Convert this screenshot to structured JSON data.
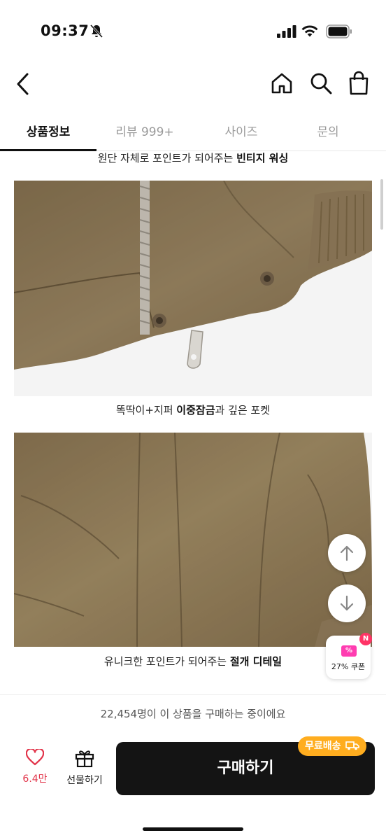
{
  "status_bar": {
    "time": "09:37"
  },
  "tabs": [
    {
      "label": "상품정보"
    },
    {
      "label": "리뷰 999+"
    },
    {
      "label": "사이즈"
    },
    {
      "label": "문의"
    }
  ],
  "captions": {
    "vintage_prefix": "원단 자체로 포인트가 되어주는 ",
    "vintage_bold": "빈티지 워싱",
    "zipper_prefix": "똑딱이+지퍼 ",
    "zipper_bold": "이중잠금",
    "zipper_suffix": "과 깊은 포켓",
    "detail_prefix": "유니크한 포인트가 되어주는 ",
    "detail_bold": "절개 디테일"
  },
  "floating": {
    "coupon_label": "27% 쿠폰",
    "coupon_badge": "N",
    "coupon_icon": "%"
  },
  "purchase": {
    "buyers_text": "22,454명이 이 상품을 구매하는 중이에요",
    "like_count": "6.4만",
    "gift_label": "선물하기",
    "buy_label": "구매하기",
    "free_shipping": "무료배송"
  },
  "colors": {
    "accent_pink": "#ff3db1",
    "like_red": "#e2344a",
    "shipping_orange": "#ffad1f",
    "fabric_brown": "#8a7654"
  }
}
